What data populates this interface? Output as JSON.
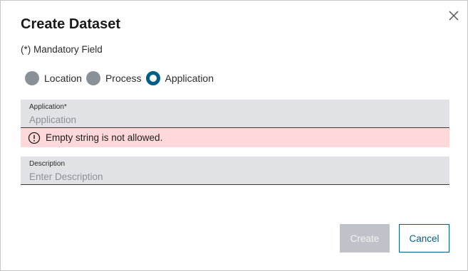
{
  "dialog": {
    "title": "Create Dataset",
    "mandatory_note": "(*) Mandatory Field"
  },
  "radio_group": {
    "options": [
      {
        "label": "Location",
        "selected": false
      },
      {
        "label": "Process",
        "selected": false
      },
      {
        "label": "Application",
        "selected": true
      }
    ]
  },
  "fields": {
    "application": {
      "label": "Application*",
      "value": "",
      "placeholder": "Application",
      "error": "Empty string is not allowed."
    },
    "description": {
      "label": "Description",
      "value": "",
      "placeholder": "Enter Description"
    }
  },
  "buttons": {
    "create_label": "Create",
    "create_disabled": true,
    "cancel_label": "Cancel"
  },
  "colors": {
    "accent": "#005f87",
    "field_bg": "#e0e2e6",
    "error_bg": "#ffd9d9",
    "disabled_btn": "#bfc3c9",
    "radio_unselected": "#8a9097"
  },
  "icons": {
    "close": "close-icon",
    "error": "error-circle-icon"
  }
}
